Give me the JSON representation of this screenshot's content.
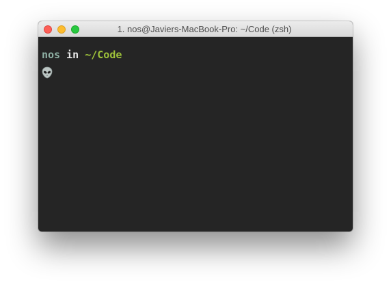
{
  "window": {
    "title": "1. nos@Javiers-MacBook-Pro: ~/Code (zsh)"
  },
  "terminal": {
    "prompt_user": "nos",
    "prompt_in": "in",
    "prompt_path": "~/Code",
    "prompt_symbol_icon": "alien-icon"
  },
  "colors": {
    "background": "#252525",
    "user": "#8fb1a5",
    "path": "#9ec23a"
  }
}
